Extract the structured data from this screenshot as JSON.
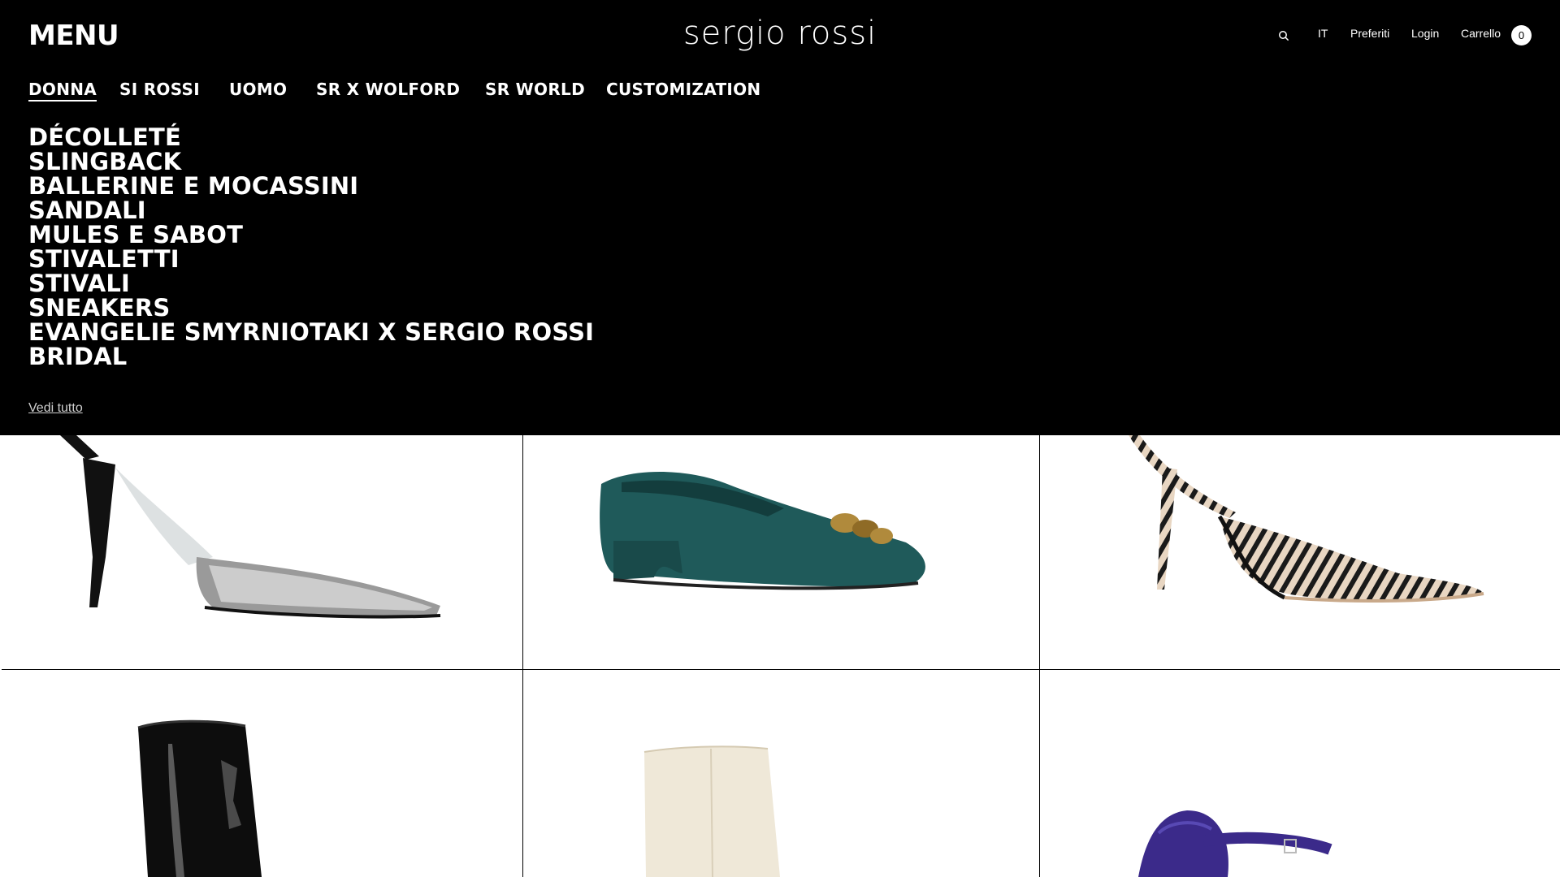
{
  "header": {
    "menu_label": "MENU",
    "logo_text": "sergio rossi",
    "language": "IT",
    "favorites": "Preferiti",
    "login": "Login",
    "cart_label": "Carrello",
    "cart_count": "0",
    "search_icon": "search-icon"
  },
  "top_nav": [
    {
      "label": "DONNA",
      "active": true
    },
    {
      "label": "SI ROSSI",
      "active": false
    },
    {
      "label": "UOMO",
      "active": false
    },
    {
      "label": "SR X WOLFORD",
      "active": false
    },
    {
      "label": "SR WORLD",
      "active": false
    },
    {
      "label": "CUSTOMIZATION",
      "active": false
    }
  ],
  "sub_nav": [
    "DÉCOLLETÉ",
    "SLINGBACK",
    "BALLERINE E MOCASSINI",
    "SANDALI",
    "MULES E SABOT",
    "STIVALETTI",
    "STIVALI",
    "SNEAKERS",
    "EVANGELIE SMYRNIOTAKI X SERGIO ROSSI",
    "BRIDAL"
  ],
  "see_all": "Vedi tutto",
  "colors": {
    "overlay_bg": "#000000",
    "text_primary": "#ffffff",
    "page_bg": "#ffffff"
  },
  "products": [
    {
      "name": "crystal-slingback-pump",
      "color": "#1a1a1a"
    },
    {
      "name": "teal-chain-loafer",
      "color": "#1f5a5a"
    },
    {
      "name": "zebra-print-slingback",
      "color": "#e5d3c0"
    },
    {
      "name": "black-patent-ankle-boot",
      "color": "#0d0d0d"
    },
    {
      "name": "cream-ankle-boot",
      "color": "#efe8d8"
    },
    {
      "name": "purple-patent-mary-jane",
      "color": "#3b2a8a"
    }
  ]
}
